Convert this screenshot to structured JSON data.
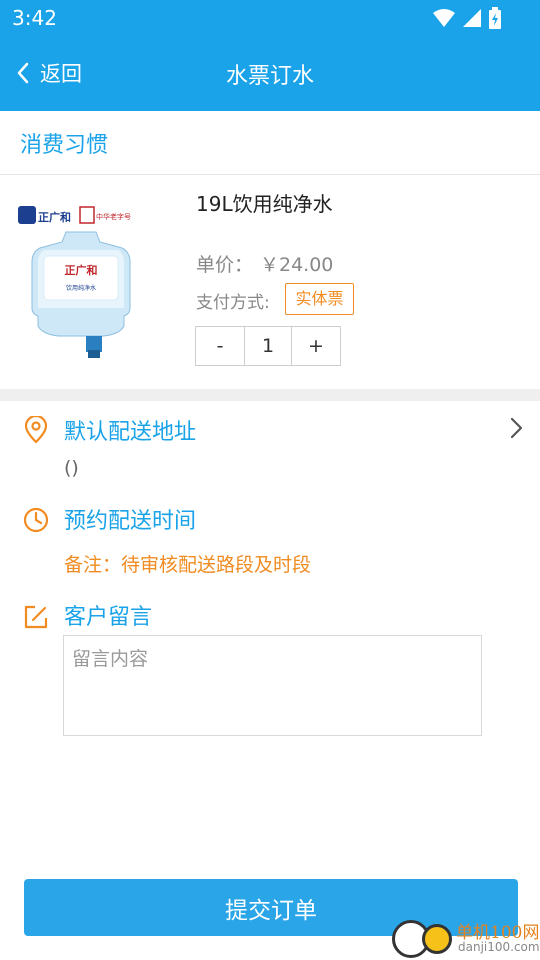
{
  "status_bar": {
    "time": "3:42",
    "icons": [
      "wifi-icon",
      "cell-signal-icon",
      "battery-charging-icon"
    ]
  },
  "app_bar": {
    "back_label": "返回",
    "title": "水票订水",
    "back_icon": "chevron-left-icon"
  },
  "section": {
    "label": "消费习惯"
  },
  "product": {
    "name": "19L饮用纯净水",
    "price_label": "单价：",
    "price": "￥24.00",
    "pay_label": "支付方式:",
    "pay_method": "实体票",
    "image_brand_text": "正广和",
    "image_tag_text": "中华老字号",
    "quantity": {
      "minus_label": "-",
      "value": "1",
      "plus_label": "+"
    }
  },
  "address": {
    "title": "默认配送地址",
    "value": "()",
    "icon": "location-pin-icon"
  },
  "delivery_time": {
    "title": "预约配送时间",
    "note": "备注：待审核配送路段及时段",
    "icon": "clock-icon"
  },
  "message": {
    "title": "客户留言",
    "placeholder": "留言内容",
    "icon": "edit-icon"
  },
  "submit": {
    "label": "提交订单"
  },
  "watermark": {
    "line1": "单机100网",
    "line2": "danji100.com"
  },
  "colors": {
    "primary": "#1aa3e8",
    "accent": "#f08c22",
    "button": "#2aa6e8"
  }
}
